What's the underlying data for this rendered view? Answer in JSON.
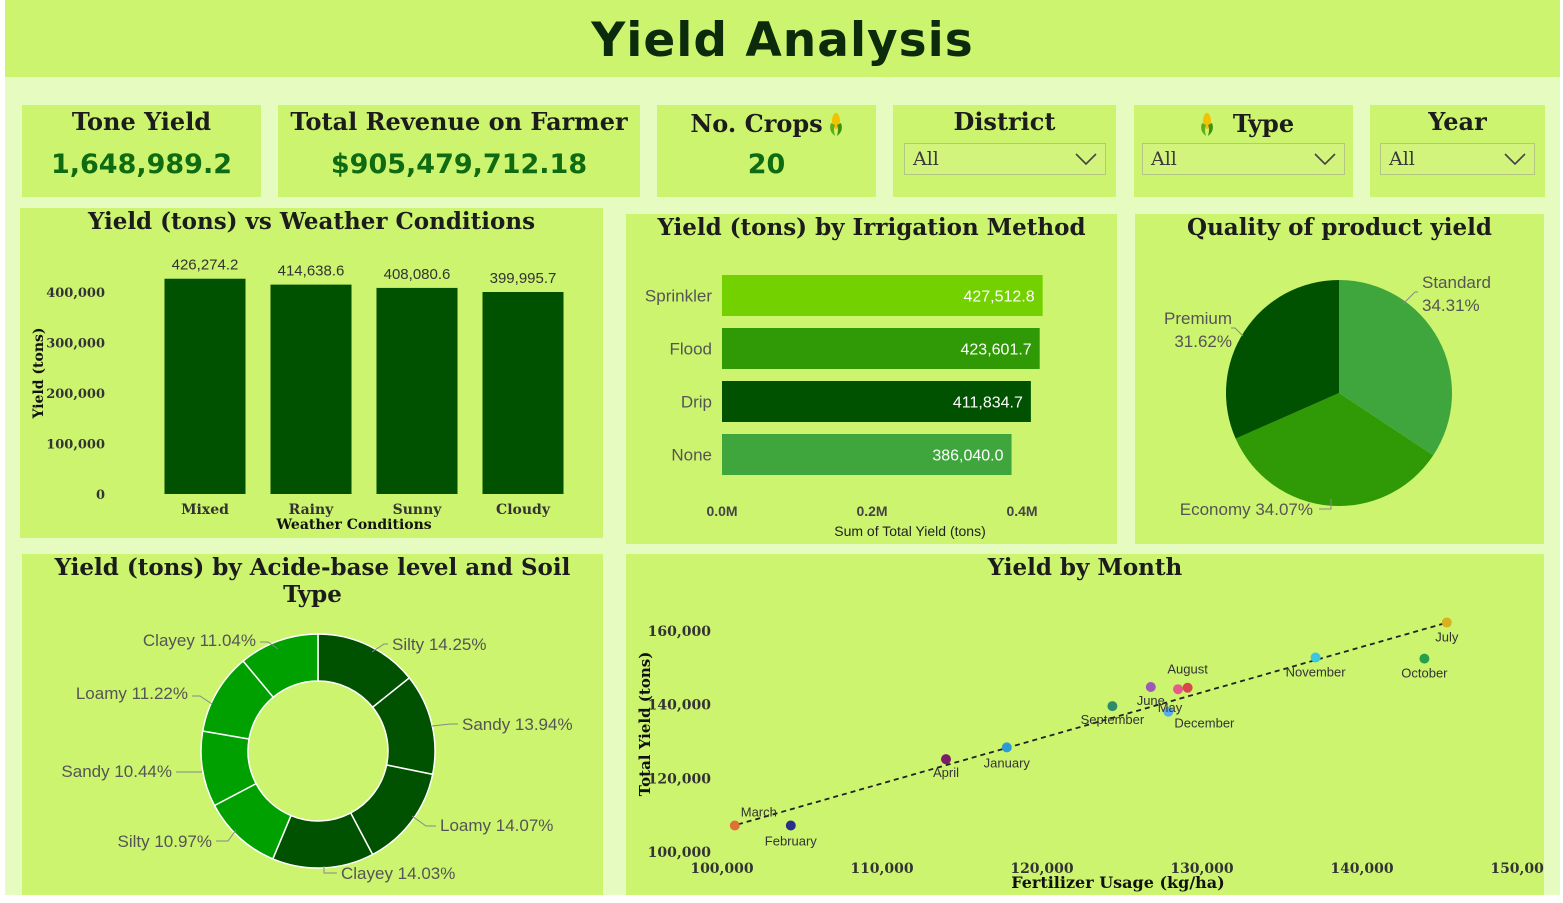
{
  "header": {
    "title": "Yield Analysis"
  },
  "kpis": {
    "tone_yield": {
      "label": "Tone Yield",
      "value": "1,648,989.2"
    },
    "revenue": {
      "label": "Total Revenue on Farmer",
      "value": "$905,479,712.18"
    },
    "crops": {
      "label": "No. Crops",
      "value": "20",
      "icon": "corn-icon"
    }
  },
  "slicers": {
    "district": {
      "label": "District",
      "value": "All"
    },
    "type": {
      "label": "Type",
      "value": "All",
      "icon": "corn-icon"
    },
    "year": {
      "label": "Year",
      "value": "All"
    }
  },
  "colors": {
    "background": "#e6fbc0",
    "card": "#ccf46f",
    "dark_green": "#005100",
    "bright_green": "#74d100",
    "mid_green": "#2f9a05",
    "light_green": "#3fa63d"
  },
  "chart_data": [
    {
      "id": "weather",
      "type": "bar",
      "title": "Yield (tons) vs Weather Conditions",
      "xlabel": "Weather Conditions",
      "ylabel": "Yield (tons)",
      "categories": [
        "Mixed",
        "Rainy",
        "Sunny",
        "Cloudy"
      ],
      "values": [
        426274.2,
        414638.6,
        408080.6,
        399995.7
      ],
      "value_labels": [
        "426,274.2",
        "414,638.6",
        "408,080.6",
        "399,995.7"
      ],
      "ylim": [
        0,
        400000
      ],
      "yticks": [
        "0",
        "100,000",
        "200,000",
        "300,000",
        "400,000"
      ]
    },
    {
      "id": "irrigation",
      "type": "bar",
      "orientation": "horizontal",
      "title": "Yield (tons) by Irrigation Method",
      "xlabel": "Sum of Total Yield (tons)",
      "categories": [
        "Sprinkler",
        "Flood",
        "Drip",
        "None"
      ],
      "values": [
        427512.8,
        423601.7,
        411834.7,
        386040.0
      ],
      "value_labels": [
        "427,512.8",
        "423,601.7",
        "411,834.7",
        "386,040.0"
      ],
      "bar_colors": [
        "#74d100",
        "#2f9a05",
        "#005100",
        "#3fa63d"
      ],
      "xticks": [
        "0.0M",
        "0.2M",
        "0.4M"
      ]
    },
    {
      "id": "quality",
      "type": "pie",
      "title": "Quality of product yield",
      "slices": [
        {
          "label": "Standard",
          "pct_text": "34.31%",
          "value": 34.31,
          "color": "#3fa63d"
        },
        {
          "label": "Economy",
          "pct_text": "34.07%",
          "value": 34.07,
          "color": "#2f9a05"
        },
        {
          "label": "Premium",
          "pct_text": "31.62%",
          "value": 31.62,
          "color": "#005100"
        }
      ]
    },
    {
      "id": "soil",
      "type": "pie",
      "subtype": "donut",
      "title": "Yield (tons) by Acide-base level and Soil Type",
      "slices": [
        {
          "label": "Silty 14.25%",
          "value": 14.25,
          "color": "#005100"
        },
        {
          "label": "Sandy 13.94%",
          "value": 13.94,
          "color": "#005100"
        },
        {
          "label": "Loamy 14.07%",
          "value": 14.07,
          "color": "#005100"
        },
        {
          "label": "Clayey 14.03%",
          "value": 14.03,
          "color": "#005100"
        },
        {
          "label": "Silty 10.97%",
          "value": 10.97,
          "color": "#00a000"
        },
        {
          "label": "Sandy 10.44%",
          "value": 10.44,
          "color": "#00a000"
        },
        {
          "label": "Loamy 11.22%",
          "value": 11.22,
          "color": "#00a000"
        },
        {
          "label": "Clayey 11.04%",
          "value": 11.04,
          "color": "#00a000"
        }
      ]
    },
    {
      "id": "month",
      "type": "scatter",
      "title": "Yield by Month",
      "xlabel": "Fertilizer Usage (kg/ha)",
      "ylabel": "Total Yield (tons)",
      "xlim": [
        100000,
        150000
      ],
      "ylim": [
        100000,
        160000
      ],
      "xticks": [
        "100,000",
        "110,000",
        "120,000",
        "130,000",
        "140,000",
        "150,000"
      ],
      "yticks": [
        "100,000",
        "120,000",
        "140,000",
        "160,000"
      ],
      "trendline": {
        "x": [
          101000,
          145500
        ],
        "y": [
          107500,
          162500
        ]
      },
      "points": [
        {
          "label": "March",
          "x": 100800,
          "y": 107200,
          "color": "#e0703a"
        },
        {
          "label": "February",
          "x": 104300,
          "y": 107200,
          "color": "#27308a"
        },
        {
          "label": "April",
          "x": 114000,
          "y": 125200,
          "color": "#7a1c6a"
        },
        {
          "label": "January",
          "x": 117800,
          "y": 128400,
          "color": "#2a9bd8"
        },
        {
          "label": "September",
          "x": 124400,
          "y": 139600,
          "color": "#2d8a6a"
        },
        {
          "label": "June",
          "x": 126800,
          "y": 144800,
          "color": "#9a5ab8"
        },
        {
          "label": "December",
          "x": 127900,
          "y": 138100,
          "color": "#5aaaee"
        },
        {
          "label": "May",
          "x": 128500,
          "y": 144200,
          "color": "#e85a8a"
        },
        {
          "label": "August",
          "x": 129100,
          "y": 144600,
          "color": "#d94848"
        },
        {
          "label": "November",
          "x": 137100,
          "y": 152800,
          "color": "#3cc6e0"
        },
        {
          "label": "October",
          "x": 143900,
          "y": 152500,
          "color": "#28a048"
        },
        {
          "label": "July",
          "x": 145300,
          "y": 162300,
          "color": "#d8b020"
        }
      ]
    }
  ]
}
